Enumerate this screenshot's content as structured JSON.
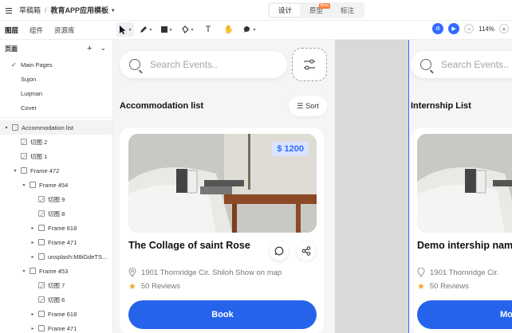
{
  "topbar": {
    "breadcrumb_root": "草稿箱",
    "breadcrumb_sep": "/",
    "project_name": "教育APP应用模板",
    "modes": [
      "设计",
      "原型",
      "标注"
    ],
    "beta_badge": "Beta"
  },
  "toolbar": {
    "tabs": [
      "图层",
      "组件",
      "资源库"
    ],
    "zoom": "114%",
    "zoom_minus": "−",
    "zoom_plus": "+"
  },
  "pages": {
    "header": "页面",
    "items": [
      "Main Pages",
      "Sujon",
      "Luqman",
      "Cover"
    ],
    "current": "Main Pages"
  },
  "layers": [
    {
      "label": "Accommodation list",
      "depth": 0,
      "arrow": "▾",
      "type": "frame",
      "selected": true
    },
    {
      "label": "切图 2",
      "depth": 1,
      "arrow": "",
      "type": "img"
    },
    {
      "label": "切图 1",
      "depth": 1,
      "arrow": "",
      "type": "img"
    },
    {
      "label": "Frame 472",
      "depth": 1,
      "arrow": "▾",
      "type": "frame"
    },
    {
      "label": "Frame 454",
      "depth": 2,
      "arrow": "▾",
      "type": "frame"
    },
    {
      "label": "切图 9",
      "depth": 3,
      "arrow": "",
      "type": "img"
    },
    {
      "label": "切图 8",
      "depth": 3,
      "arrow": "",
      "type": "img"
    },
    {
      "label": "Frame 618",
      "depth": 3,
      "arrow": "▸",
      "type": "frame"
    },
    {
      "label": "Frame 471",
      "depth": 3,
      "arrow": "▸",
      "type": "frame"
    },
    {
      "label": "unsplash:M8iGdeTS...",
      "depth": 3,
      "arrow": "▸",
      "type": "frame"
    },
    {
      "label": "Frame 453",
      "depth": 2,
      "arrow": "▾",
      "type": "frame"
    },
    {
      "label": "切图 7",
      "depth": 3,
      "arrow": "",
      "type": "img"
    },
    {
      "label": "切图 6",
      "depth": 3,
      "arrow": "",
      "type": "img"
    },
    {
      "label": "Frame 618",
      "depth": 3,
      "arrow": "▸",
      "type": "frame"
    },
    {
      "label": "Frame 471",
      "depth": 3,
      "arrow": "▸",
      "type": "frame"
    }
  ],
  "frame_a": {
    "search_placeholder": "Search Events..",
    "section_title": "Accommodation list",
    "sort_label": "Sort",
    "price": "$ 1200",
    "card_title": "The Collage of saint Rose",
    "address": "1901 Thornridge Cir. Shiloh Show on map",
    "reviews": "50 Reviews",
    "book_label": "Book"
  },
  "frame_b": {
    "search_placeholder": "Search Events..",
    "section_title": "Internship List",
    "card_title": "Demo intership nam",
    "address": "1901 Thornridge Cir.",
    "reviews": "50 Reviews",
    "button_label": "Mo"
  },
  "colors": {
    "accent": "#2563eb",
    "price_bg": "#dbe4ff",
    "star": "#f5a623",
    "canvas_bg": "#f5f5f5"
  }
}
